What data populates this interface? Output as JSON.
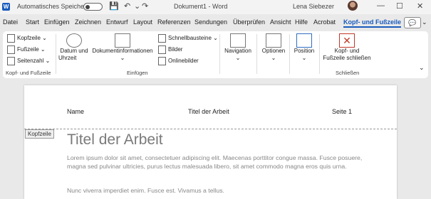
{
  "app": {
    "logo": "W",
    "autosave_label": "Automatisches Speichern",
    "doc_title": "Dokument1 - Word",
    "user": "Lena Siebezer"
  },
  "icons": {
    "save": "💾",
    "undo": "↶",
    "redo": "↷",
    "minimize": "—",
    "maximize": "☐",
    "close": "✕",
    "comments": "💬",
    "chevron": "⌄"
  },
  "tabs": [
    {
      "label": "Datei",
      "active": false
    },
    {
      "label": "Start",
      "active": false
    },
    {
      "label": "Einfügen",
      "active": false
    },
    {
      "label": "Zeichnen",
      "active": false
    },
    {
      "label": "Entwurf",
      "active": false
    },
    {
      "label": "Layout",
      "active": false
    },
    {
      "label": "Referenzen",
      "active": false
    },
    {
      "label": "Sendungen",
      "active": false
    },
    {
      "label": "Überprüfen",
      "active": false
    },
    {
      "label": "Ansicht",
      "active": false
    },
    {
      "label": "Hilfe",
      "active": false
    },
    {
      "label": "Acrobat",
      "active": false
    },
    {
      "label": "Kopf- und Fußzeile",
      "active": true
    }
  ],
  "ribbon": {
    "kf_group": {
      "kopfzeile": "Kopfzeile",
      "fusszeile": "Fußzeile",
      "seitenzahl": "Seitenzahl",
      "label": "Kopf- und Fußzeile"
    },
    "einfuegen_group": {
      "datum_line1": "Datum und",
      "datum_line2": "Uhrzeit",
      "dokinfo": "Dokumentinformationen",
      "schnellbausteine": "Schnellbausteine",
      "bilder": "Bilder",
      "onlinebilder": "Onlinebilder",
      "label": "Einfügen"
    },
    "navigation": "Navigation",
    "optionen": "Optionen",
    "position": "Position",
    "schliessen_group": {
      "line1": "Kopf- und",
      "line2": "Fußzeile schließen",
      "label": "Schließen"
    }
  },
  "document": {
    "header": {
      "left": "Name",
      "center": "Titel der Arbeit",
      "right": "Seite 1",
      "tag": "Kopfzeile"
    },
    "title": "Titel der Arbeit",
    "para1": "Lorem ipsum dolor sit amet, consectetuer adipiscing elit. Maecenas porttitor congue massa. Fusce posuere, magna sed pulvinar ultricies, purus lectus malesuada libero, sit amet commodo magna eros quis urna.",
    "para2": "Nunc viverra imperdiet enim. Fusce est. Vivamus a tellus."
  }
}
